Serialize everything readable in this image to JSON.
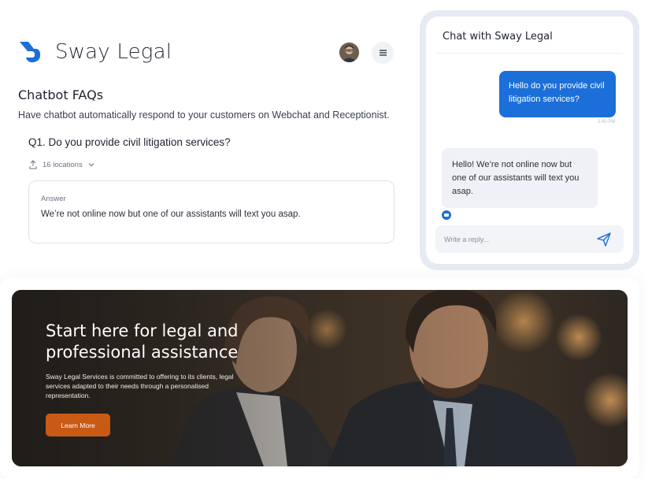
{
  "brand": {
    "name": "Sway Legal",
    "accent_color": "#1c6fd8",
    "logo_icon": "sway-logo-icon"
  },
  "header": {
    "avatar_icon": "user-avatar",
    "menu_icon": "hamburger-menu-icon"
  },
  "faq": {
    "title": "Chatbot FAQs",
    "subtitle": "Have chatbot automatically respond to your customers on Webchat and Receptionist.",
    "question": "Q1. Do you provide civil litigation services?",
    "locations_label": "16 locations",
    "answer_label": "Answer",
    "answer_text": "We’re not online now but one of our assistants will text you asap."
  },
  "chat": {
    "title": "Chat with Sway Legal",
    "outgoing_message": "Hello do you provide civil litigation services?",
    "outgoing_time": "2:40 PM",
    "incoming_message": "Hello! We’re not online now but one of our assistants will text you asap.",
    "reply_placeholder": "Write a reply...",
    "send_icon": "send-icon"
  },
  "hero": {
    "title": "Start here for legal and professional assistance",
    "description": "Sway Legal Services is committed to offering to its clients, legal services adapted to their needs through a personalised representation.",
    "button_label": "Learn More",
    "button_color": "#c85a16"
  }
}
